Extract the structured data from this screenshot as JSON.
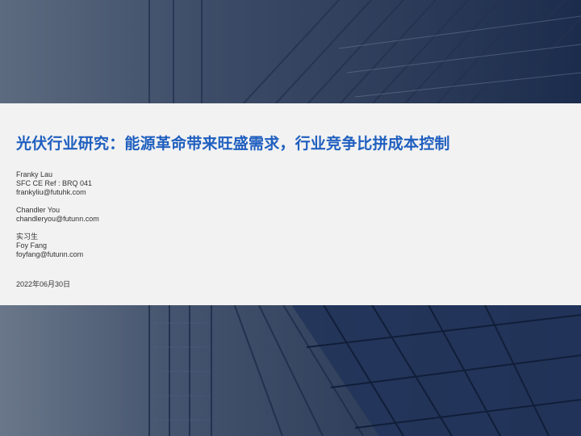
{
  "report": {
    "title": "光伏行业研究：能源革命带来旺盛需求，行业竞争比拼成本控制",
    "date": "2022年06月30日"
  },
  "authors": [
    {
      "name": "Franky Lau",
      "license": "SFC CE Ref : BRQ 041",
      "email": "frankyliu@futuhk.com"
    },
    {
      "name": "Chandler You",
      "email": "chandleryou@futunn.com"
    },
    {
      "role": "实习生",
      "name": "Foy Fang",
      "email": "foyfang@futunn.com"
    }
  ],
  "colors": {
    "title": "#1f5fbf",
    "band": "#f2f2f2",
    "background": "#2b3a55"
  }
}
